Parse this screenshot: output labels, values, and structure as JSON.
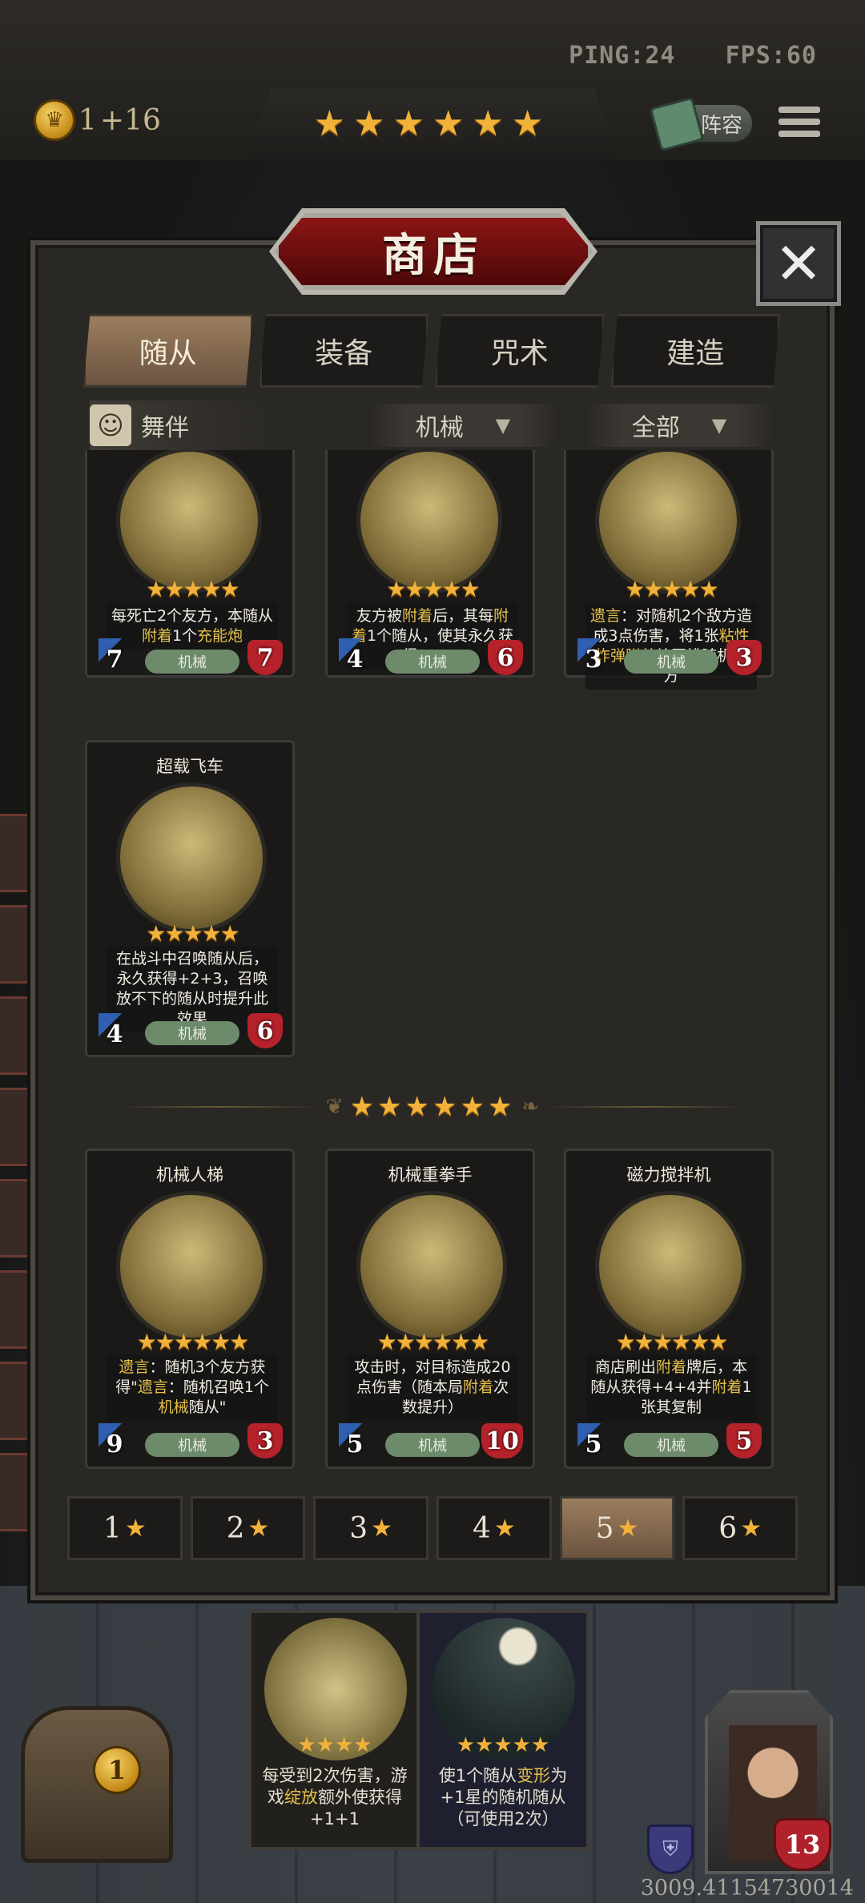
{
  "hud": {
    "ping": "PING:24",
    "fps": "FPS:60",
    "gold": "1",
    "gold_income": "+16",
    "roster_label": "阵容",
    "tier_stars": "★★★★★★"
  },
  "shop": {
    "title": "商店",
    "close_label": "✕",
    "tabs": [
      {
        "label": "随从",
        "active": true
      },
      {
        "label": "装备",
        "active": false
      },
      {
        "label": "咒术",
        "active": false
      },
      {
        "label": "建造",
        "active": false
      }
    ],
    "partner_label": "舞伴",
    "filter_tribe": "机械",
    "filter_all": "全部",
    "divider_stars": "★★★★★★",
    "tiers": [
      {
        "label": "1",
        "active": false
      },
      {
        "label": "2",
        "active": false
      },
      {
        "label": "3",
        "active": false
      },
      {
        "label": "4",
        "active": false
      },
      {
        "label": "5",
        "active": true
      },
      {
        "label": "6",
        "active": false
      }
    ]
  },
  "cards_tier5": [
    {
      "name": "",
      "stars": "★★★★★",
      "text_html": "每死亡2个友方，本随从<span class='kw'>附着</span>1个<span class='kw'>充能炮</span>",
      "attack": "7",
      "health": "7",
      "tribe": "机械"
    },
    {
      "name": "",
      "stars": "★★★★★",
      "text_html": "友方被<span class='kw'>附着</span>后，其每<span class='kw'>附着</span>1个随从，使其永久获得+1+1",
      "attack": "4",
      "health": "6",
      "tribe": "机械"
    },
    {
      "name": "",
      "stars": "★★★★★",
      "text_html": "<span class='kw'>遗言</span>：对随机2个敌方造成3点伤害，将1张<span class='kw'>粘性炸弹</span><span class='kw'>附着</span>给同排随机友方",
      "attack": "3",
      "health": "3",
      "tribe": "机械"
    },
    {
      "name": "超载飞车",
      "stars": "★★★★★",
      "text_html": "在战斗中召唤随从后，永久获得+2+3，召唤放不下的随从时提升此效果",
      "attack": "4",
      "health": "6",
      "tribe": "机械"
    }
  ],
  "cards_tier6": [
    {
      "name": "机械人梯",
      "stars": "★★★★★★",
      "text_html": "<span class='kw'>遗言</span>：随机3个友方获得\"<span class='kw'>遗言</span>：随机召唤1个<span class='kw'>机械</span>随从\"",
      "attack": "9",
      "health": "3",
      "tribe": "机械"
    },
    {
      "name": "机械重拳手",
      "stars": "★★★★★★",
      "text_html": "攻击时，对目标造成20点伤害（随本局<span class='kw'>附着</span>次数提升）",
      "attack": "5",
      "health": "10",
      "tribe": "机械"
    },
    {
      "name": "磁力搅拌机",
      "stars": "★★★★★★",
      "text_html": "商店刷出<span class='kw'>附着</span>牌后，本随从获得+4+4并<span class='kw'>附着</span>1张其复制",
      "attack": "5",
      "health": "5",
      "tribe": "机械"
    }
  ],
  "hand": [
    {
      "stars": "★★★★",
      "text_html": "每受到2次伤害，游戏<span class='kw'>绽放</span>额外使获得+1+1"
    },
    {
      "stars": "★★★★★",
      "text_html": "使1个随从<span class='kw'>变形</span>为+1星的随机随从（可使用2次）"
    }
  ],
  "bottom": {
    "chest_count": "1",
    "hero_health": "13",
    "coords": "3009.41154730014"
  },
  "colors": {
    "accent_gold": "#f2b23a",
    "title_red": "#8c1515",
    "keyword": "#e6c14a",
    "health_red": "#b6222a",
    "attack_blue": "#2f5fb0",
    "tribe_green": "#6d8a6a"
  }
}
